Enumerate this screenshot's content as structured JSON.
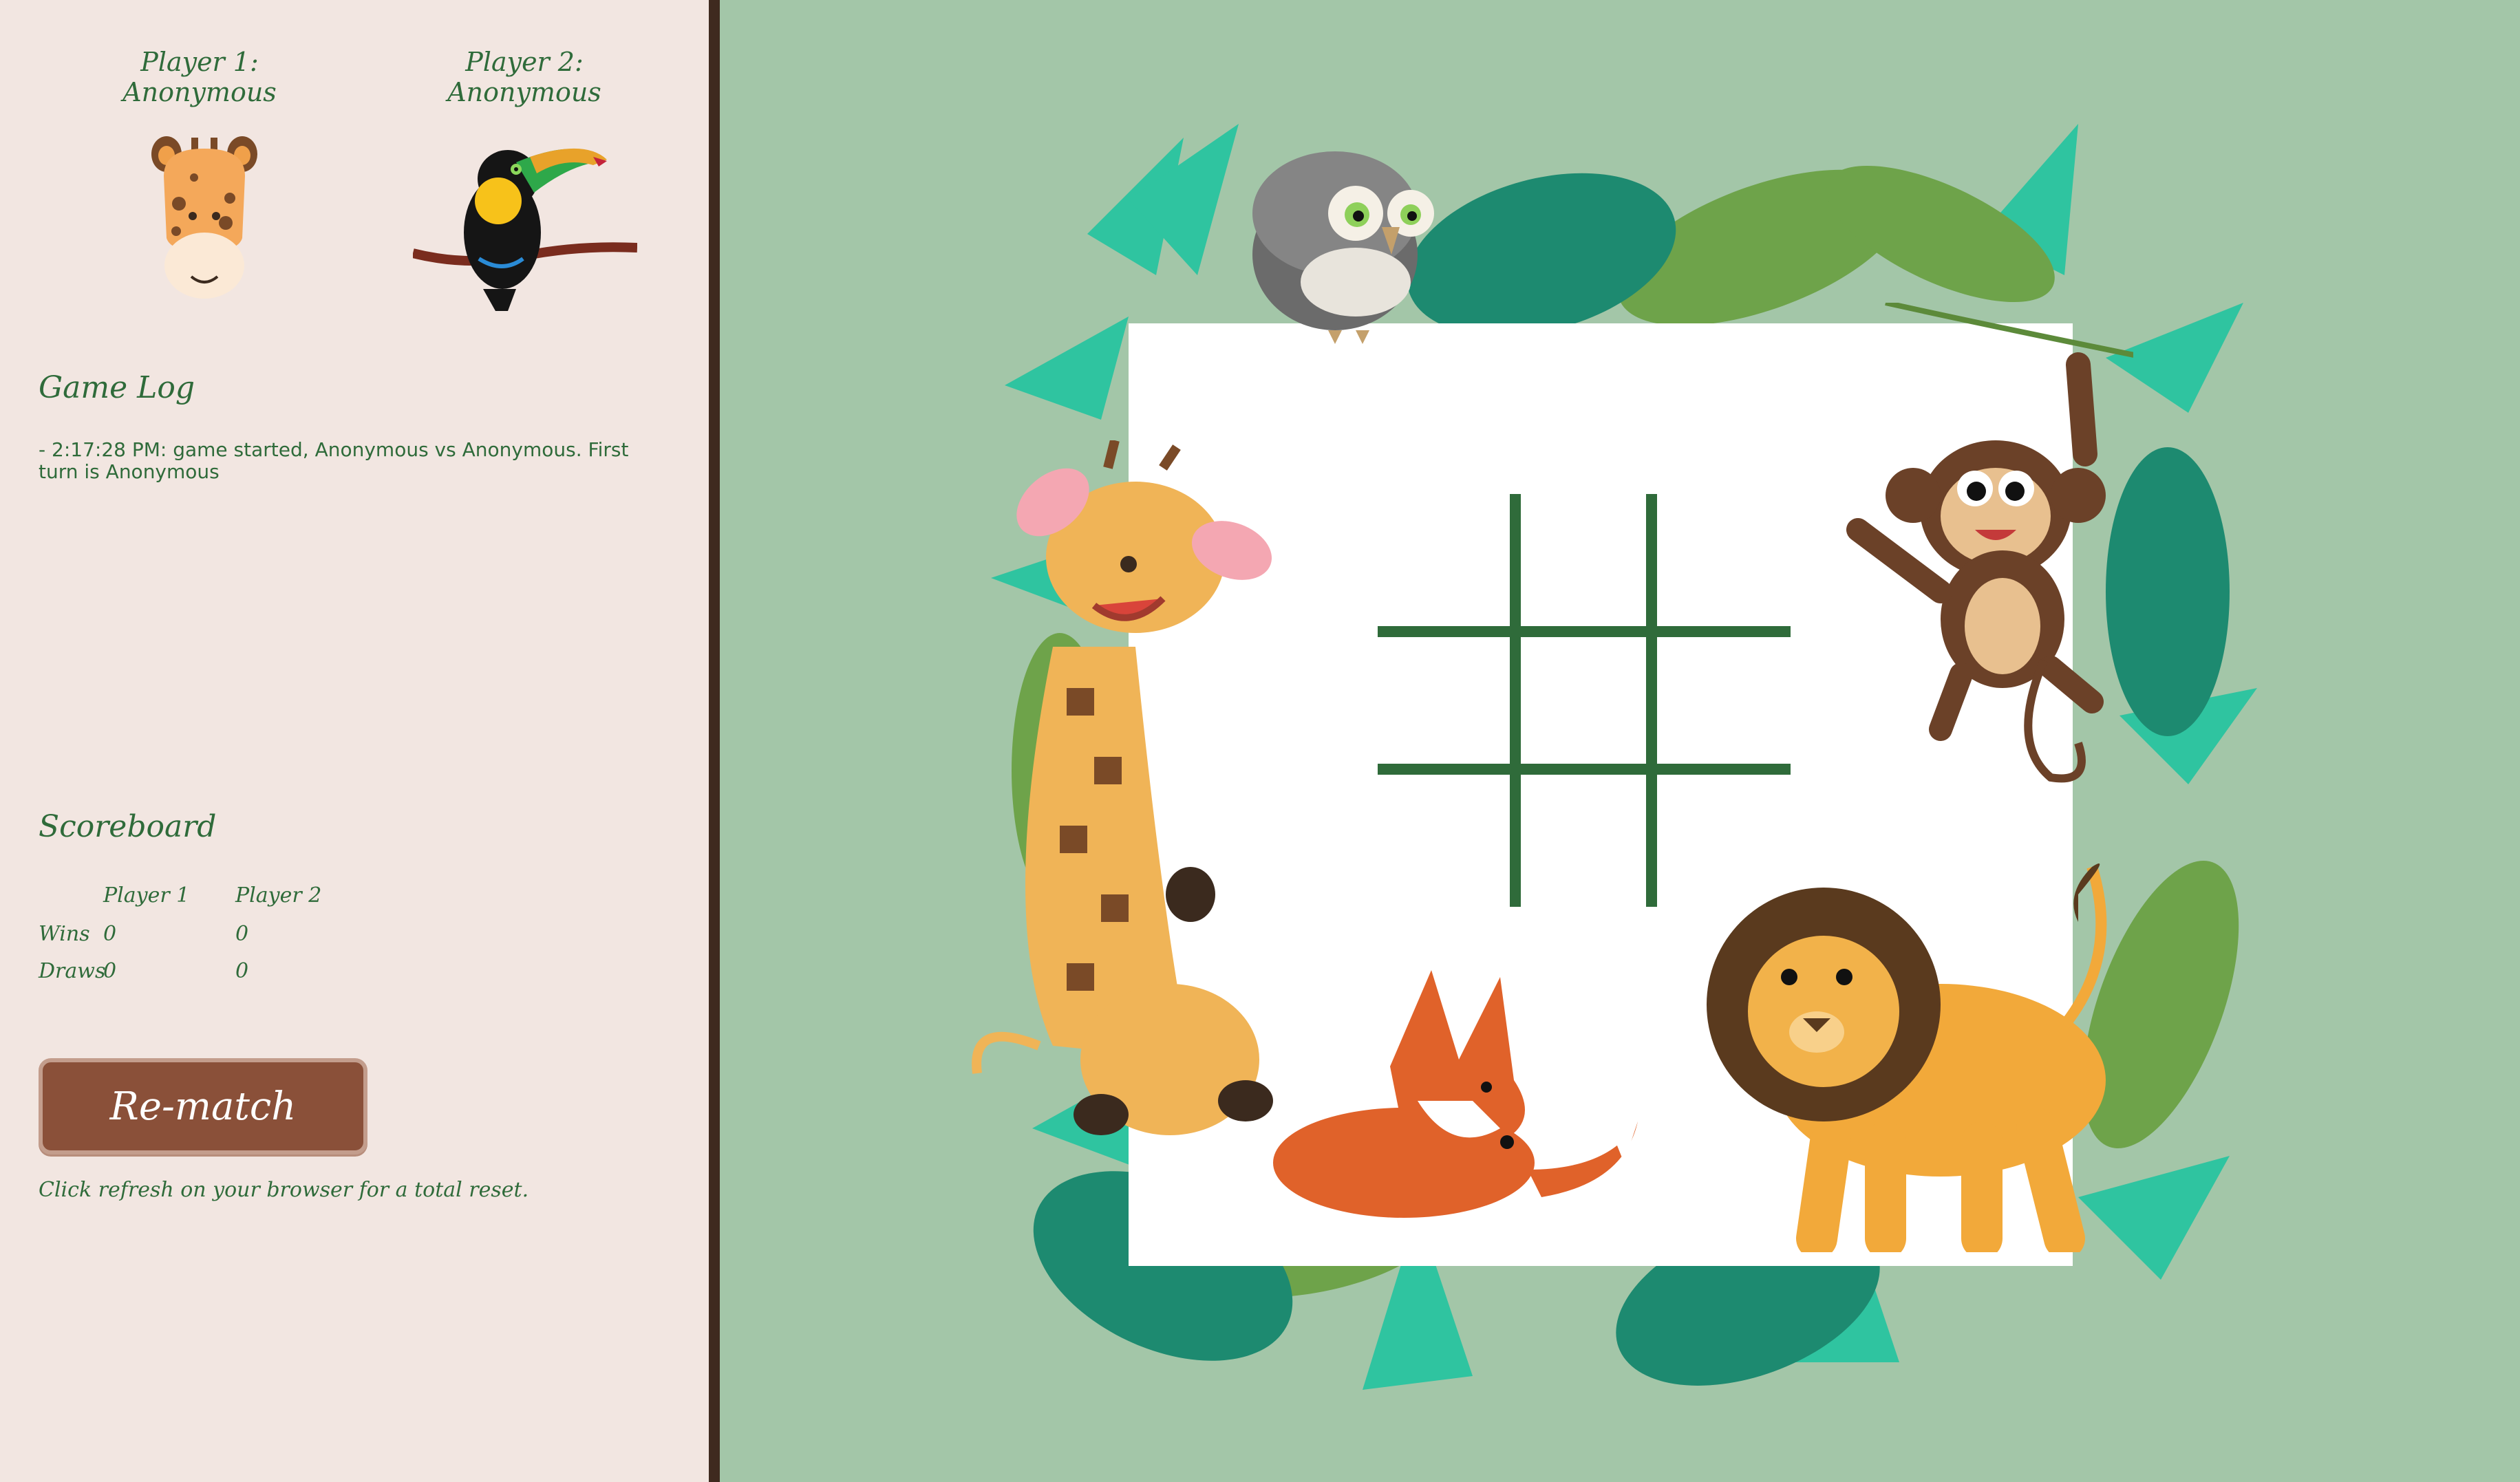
{
  "players": {
    "p1": {
      "name": "Player 1: Anonymous",
      "avatar": "giraffe-face-icon"
    },
    "p2": {
      "name": "Player 2: Anonymous",
      "avatar": "toucan-icon"
    }
  },
  "game_log": {
    "title": "Game Log",
    "entries": [
      "- 2:17:28 PM: game started, Anonymous vs Anonymous. First turn is Anonymous"
    ]
  },
  "scoreboard": {
    "title": "Scoreboard",
    "headers": [
      "Player 1",
      "Player 2"
    ],
    "rows": [
      {
        "label": "Wins",
        "p1": "0",
        "p2": "0"
      },
      {
        "label": "Draws",
        "p1": "0",
        "p2": "0"
      }
    ]
  },
  "rematch": {
    "label": "Re-match"
  },
  "reset_note": "Click refresh on your browser for a total reset.",
  "board": {
    "cells": [
      "",
      "",
      "",
      "",
      "",
      "",
      "",
      "",
      ""
    ],
    "decorations": [
      "owl-icon",
      "monkey-icon",
      "giraffe-icon",
      "fox-icon",
      "lion-icon",
      "jungle-leaves"
    ]
  },
  "colors": {
    "sidebar_bg": "#f2e6e1",
    "stage_bg": "#a3c6a8",
    "accent_green": "#2f6b3a",
    "button_brown": "#8a5039",
    "divider": "#3f2a1f"
  }
}
